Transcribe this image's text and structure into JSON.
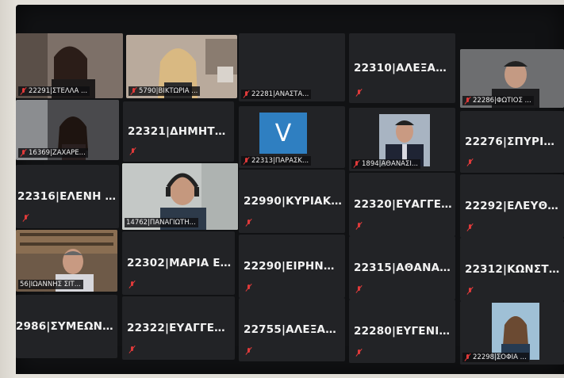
{
  "participants": [
    {
      "id": "p1",
      "label": "22291|ΣΤΕΛΛΑ ...",
      "video": true
    },
    {
      "id": "p2",
      "label": "5790|ΒΙΚΤΩΡΙΑ ...",
      "video": true
    },
    {
      "id": "p3",
      "label": "22281|ΑΝΑΣΤΑ...",
      "video": false
    },
    {
      "id": "p4",
      "label": "22310|ΑΛΕΞΑΝ...",
      "video": false
    },
    {
      "id": "p5",
      "label": "22286|ΦΩΤΙΟΣ ...",
      "video": true
    },
    {
      "id": "p6",
      "label": "16369|ΖΑΧΑΡΕ...",
      "video": true
    },
    {
      "id": "p7",
      "label": "22321|ΔΗΜΗΤΡ...",
      "video": false
    },
    {
      "id": "p8",
      "label": "22313|ΠΑΡΑΣΚ...",
      "video": false,
      "avatar": "V"
    },
    {
      "id": "p9",
      "label": "1894|ΑΘΑΝΑΣΙ...",
      "video": true
    },
    {
      "id": "p10",
      "label": "22276|ΣΠΥΡΙΔΩ...",
      "video": false
    },
    {
      "id": "p11",
      "label": "22316|ΕΛΕΝΗ ...",
      "video": false
    },
    {
      "id": "p12",
      "label": "14762|ΠΑΝΑΓΙΩΤΗ...",
      "video": true
    },
    {
      "id": "p13",
      "label": "22990|ΚΥΡΙΑΚ...",
      "video": false
    },
    {
      "id": "p14",
      "label": "22320|ΕΥΑΓΓΕΛ...",
      "video": false
    },
    {
      "id": "p15",
      "label": "22292|ΕΛΕΥΘΕΡ...",
      "video": false
    },
    {
      "id": "p16",
      "label": "56|ΙΩΑΝΝΗΣ ΣΙΤ...",
      "video": true
    },
    {
      "id": "p17",
      "label": "22302|ΜΑΡΙΑ Ε...",
      "video": false
    },
    {
      "id": "p18",
      "label": "22290|ΕΙΡΗΝΗ...",
      "video": false
    },
    {
      "id": "p19",
      "label": "22315|ΑΘΑΝΑΣ...",
      "video": false
    },
    {
      "id": "p20",
      "label": "22312|ΚΩΝΣΤΑ...",
      "video": false
    },
    {
      "id": "p21",
      "label": "2986|ΣΥΜΕΩΝ...",
      "video": false
    },
    {
      "id": "p22",
      "label": "22322|ΕΥΑΓΓΕΛ...",
      "video": false
    },
    {
      "id": "p23",
      "label": "22755|ΑΛΕΞΑΝ...",
      "video": false
    },
    {
      "id": "p24",
      "label": "22280|ΕΥΓΕΝΙΑ...",
      "video": false
    },
    {
      "id": "p25",
      "label": "22298|ΣΟΦΙΑ ...",
      "video": true
    }
  ],
  "colors": {
    "tile": "#222326",
    "mic_muted": "#e03a3a",
    "speaker_border": "#e9f06a",
    "avatar_bg": "#2f7fc1"
  }
}
